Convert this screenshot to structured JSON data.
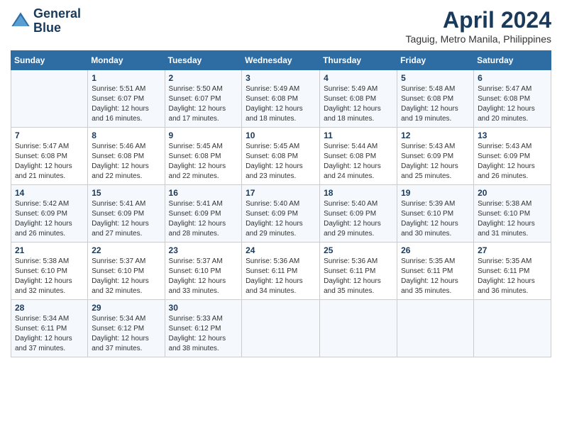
{
  "header": {
    "logo_line1": "General",
    "logo_line2": "Blue",
    "month_title": "April 2024",
    "location": "Taguig, Metro Manila, Philippines"
  },
  "weekdays": [
    "Sunday",
    "Monday",
    "Tuesday",
    "Wednesday",
    "Thursday",
    "Friday",
    "Saturday"
  ],
  "weeks": [
    [
      {
        "day": "",
        "sunrise": "",
        "sunset": "",
        "daylight": ""
      },
      {
        "day": "1",
        "sunrise": "Sunrise: 5:51 AM",
        "sunset": "Sunset: 6:07 PM",
        "daylight": "Daylight: 12 hours and 16 minutes."
      },
      {
        "day": "2",
        "sunrise": "Sunrise: 5:50 AM",
        "sunset": "Sunset: 6:07 PM",
        "daylight": "Daylight: 12 hours and 17 minutes."
      },
      {
        "day": "3",
        "sunrise": "Sunrise: 5:49 AM",
        "sunset": "Sunset: 6:08 PM",
        "daylight": "Daylight: 12 hours and 18 minutes."
      },
      {
        "day": "4",
        "sunrise": "Sunrise: 5:49 AM",
        "sunset": "Sunset: 6:08 PM",
        "daylight": "Daylight: 12 hours and 18 minutes."
      },
      {
        "day": "5",
        "sunrise": "Sunrise: 5:48 AM",
        "sunset": "Sunset: 6:08 PM",
        "daylight": "Daylight: 12 hours and 19 minutes."
      },
      {
        "day": "6",
        "sunrise": "Sunrise: 5:47 AM",
        "sunset": "Sunset: 6:08 PM",
        "daylight": "Daylight: 12 hours and 20 minutes."
      }
    ],
    [
      {
        "day": "7",
        "sunrise": "Sunrise: 5:47 AM",
        "sunset": "Sunset: 6:08 PM",
        "daylight": "Daylight: 12 hours and 21 minutes."
      },
      {
        "day": "8",
        "sunrise": "Sunrise: 5:46 AM",
        "sunset": "Sunset: 6:08 PM",
        "daylight": "Daylight: 12 hours and 22 minutes."
      },
      {
        "day": "9",
        "sunrise": "Sunrise: 5:45 AM",
        "sunset": "Sunset: 6:08 PM",
        "daylight": "Daylight: 12 hours and 22 minutes."
      },
      {
        "day": "10",
        "sunrise": "Sunrise: 5:45 AM",
        "sunset": "Sunset: 6:08 PM",
        "daylight": "Daylight: 12 hours and 23 minutes."
      },
      {
        "day": "11",
        "sunrise": "Sunrise: 5:44 AM",
        "sunset": "Sunset: 6:08 PM",
        "daylight": "Daylight: 12 hours and 24 minutes."
      },
      {
        "day": "12",
        "sunrise": "Sunrise: 5:43 AM",
        "sunset": "Sunset: 6:09 PM",
        "daylight": "Daylight: 12 hours and 25 minutes."
      },
      {
        "day": "13",
        "sunrise": "Sunrise: 5:43 AM",
        "sunset": "Sunset: 6:09 PM",
        "daylight": "Daylight: 12 hours and 26 minutes."
      }
    ],
    [
      {
        "day": "14",
        "sunrise": "Sunrise: 5:42 AM",
        "sunset": "Sunset: 6:09 PM",
        "daylight": "Daylight: 12 hours and 26 minutes."
      },
      {
        "day": "15",
        "sunrise": "Sunrise: 5:41 AM",
        "sunset": "Sunset: 6:09 PM",
        "daylight": "Daylight: 12 hours and 27 minutes."
      },
      {
        "day": "16",
        "sunrise": "Sunrise: 5:41 AM",
        "sunset": "Sunset: 6:09 PM",
        "daylight": "Daylight: 12 hours and 28 minutes."
      },
      {
        "day": "17",
        "sunrise": "Sunrise: 5:40 AM",
        "sunset": "Sunset: 6:09 PM",
        "daylight": "Daylight: 12 hours and 29 minutes."
      },
      {
        "day": "18",
        "sunrise": "Sunrise: 5:40 AM",
        "sunset": "Sunset: 6:09 PM",
        "daylight": "Daylight: 12 hours and 29 minutes."
      },
      {
        "day": "19",
        "sunrise": "Sunrise: 5:39 AM",
        "sunset": "Sunset: 6:10 PM",
        "daylight": "Daylight: 12 hours and 30 minutes."
      },
      {
        "day": "20",
        "sunrise": "Sunrise: 5:38 AM",
        "sunset": "Sunset: 6:10 PM",
        "daylight": "Daylight: 12 hours and 31 minutes."
      }
    ],
    [
      {
        "day": "21",
        "sunrise": "Sunrise: 5:38 AM",
        "sunset": "Sunset: 6:10 PM",
        "daylight": "Daylight: 12 hours and 32 minutes."
      },
      {
        "day": "22",
        "sunrise": "Sunrise: 5:37 AM",
        "sunset": "Sunset: 6:10 PM",
        "daylight": "Daylight: 12 hours and 32 minutes."
      },
      {
        "day": "23",
        "sunrise": "Sunrise: 5:37 AM",
        "sunset": "Sunset: 6:10 PM",
        "daylight": "Daylight: 12 hours and 33 minutes."
      },
      {
        "day": "24",
        "sunrise": "Sunrise: 5:36 AM",
        "sunset": "Sunset: 6:11 PM",
        "daylight": "Daylight: 12 hours and 34 minutes."
      },
      {
        "day": "25",
        "sunrise": "Sunrise: 5:36 AM",
        "sunset": "Sunset: 6:11 PM",
        "daylight": "Daylight: 12 hours and 35 minutes."
      },
      {
        "day": "26",
        "sunrise": "Sunrise: 5:35 AM",
        "sunset": "Sunset: 6:11 PM",
        "daylight": "Daylight: 12 hours and 35 minutes."
      },
      {
        "day": "27",
        "sunrise": "Sunrise: 5:35 AM",
        "sunset": "Sunset: 6:11 PM",
        "daylight": "Daylight: 12 hours and 36 minutes."
      }
    ],
    [
      {
        "day": "28",
        "sunrise": "Sunrise: 5:34 AM",
        "sunset": "Sunset: 6:11 PM",
        "daylight": "Daylight: 12 hours and 37 minutes."
      },
      {
        "day": "29",
        "sunrise": "Sunrise: 5:34 AM",
        "sunset": "Sunset: 6:12 PM",
        "daylight": "Daylight: 12 hours and 37 minutes."
      },
      {
        "day": "30",
        "sunrise": "Sunrise: 5:33 AM",
        "sunset": "Sunset: 6:12 PM",
        "daylight": "Daylight: 12 hours and 38 minutes."
      },
      {
        "day": "",
        "sunrise": "",
        "sunset": "",
        "daylight": ""
      },
      {
        "day": "",
        "sunrise": "",
        "sunset": "",
        "daylight": ""
      },
      {
        "day": "",
        "sunrise": "",
        "sunset": "",
        "daylight": ""
      },
      {
        "day": "",
        "sunrise": "",
        "sunset": "",
        "daylight": ""
      }
    ]
  ]
}
